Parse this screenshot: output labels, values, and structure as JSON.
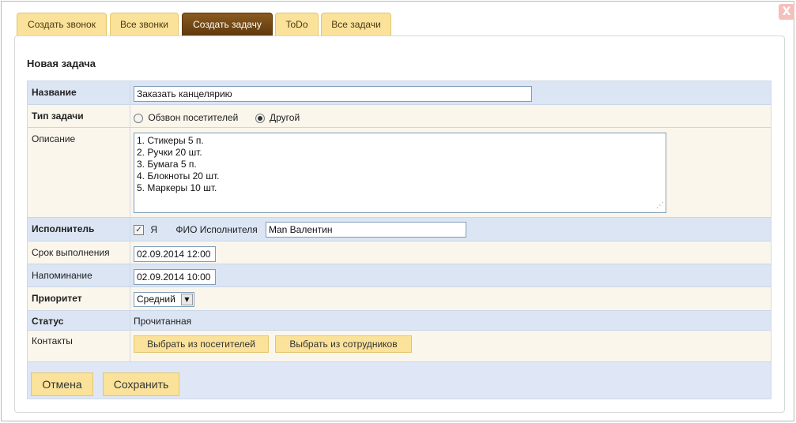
{
  "tabs": [
    {
      "label": "Создать звонок"
    },
    {
      "label": "Все звонки"
    },
    {
      "label": "Создать задачу"
    },
    {
      "label": "ToDo"
    },
    {
      "label": "Все задачи"
    }
  ],
  "close_label": "X",
  "panel_title": "Новая задача",
  "form": {
    "name": {
      "label": "Название",
      "value": "Заказать канцелярию"
    },
    "task_type": {
      "label": "Тип задачи",
      "option1": "Обзвон посетителей",
      "option2": "Другой",
      "selected": "Другой"
    },
    "description": {
      "label": "Описание",
      "value": "1. Стикеры 5 п.\n2. Ручки 20 шт.\n3. Бумага 5 п.\n4. Блокноты 20 шт.\n5. Маркеры 10 шт."
    },
    "assignee": {
      "label": "Исполнитель",
      "self_label": "Я",
      "self_checked": true,
      "fio_label": "ФИО Исполнителя",
      "fio_value": "Man Валентин"
    },
    "deadline": {
      "label": "Срок выполнения",
      "value": "02.09.2014 12:00"
    },
    "reminder": {
      "label": "Напоминание",
      "value": "02.09.2014 10:00"
    },
    "priority": {
      "label": "Приоритет",
      "value": "Средний"
    },
    "status": {
      "label": "Статус",
      "value": "Прочитанная"
    },
    "contacts": {
      "label": "Контакты",
      "btn_visitors": "Выбрать из посетителей",
      "btn_employees": "Выбрать из сотрудников"
    }
  },
  "actions": {
    "cancel": "Отмена",
    "save": "Сохранить"
  },
  "colors": {
    "tab": "#fbe29a",
    "tab_active": "#6e4514",
    "row_blue": "#dbe5f4",
    "row_cream": "#fbf6ec"
  }
}
